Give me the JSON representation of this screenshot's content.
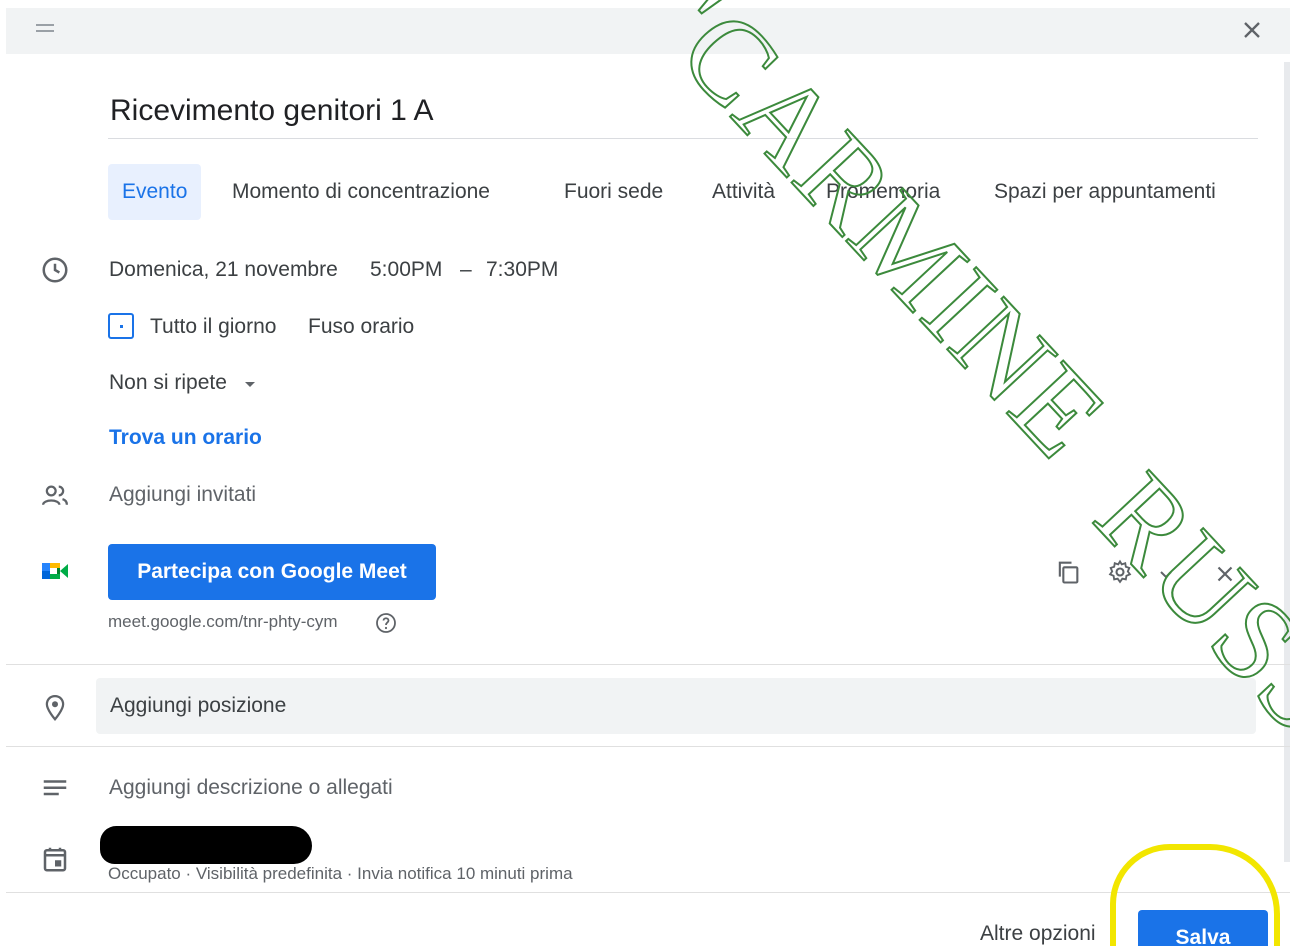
{
  "dialog": {
    "title_value": "Ricevimento genitori 1 A",
    "tabs": [
      {
        "label": "Evento",
        "active": true
      },
      {
        "label": "Momento di concentrazione"
      },
      {
        "label": "Fuori sede"
      },
      {
        "label": "Attività"
      },
      {
        "label": "Promemoria"
      },
      {
        "label": "Spazi per appuntamenti"
      }
    ],
    "datetime": {
      "date": "Domenica, 21 novembre",
      "start": "5:00PM",
      "separator": "–",
      "end": "7:30PM"
    },
    "all_day_label": "Tutto il giorno",
    "timezone_label": "Fuso orario",
    "repeat_label": "Non si ripete",
    "find_time_label": "Trova un orario",
    "guests_placeholder": "Aggiungi invitati",
    "meet": {
      "button_label": "Partecipa con Google Meet",
      "url": "meet.google.com/tnr-phty-cym"
    },
    "location_placeholder": "Aggiungi posizione",
    "description_placeholder": "Aggiungi descrizione o allegati",
    "calendar_details": "Occupato · Visibilità predefinita · Invia notifica 10 minuti prima",
    "footer": {
      "more_options_label": "Altre opzioni",
      "save_label": "Salva"
    }
  },
  "watermark": {
    "text_line_1": "\"CARMINE",
    "text_line_2": "RUSSO",
    "color": "#3c8a3c"
  },
  "colors": {
    "accent": "#1a73e8",
    "highlight": "#f2e600"
  }
}
